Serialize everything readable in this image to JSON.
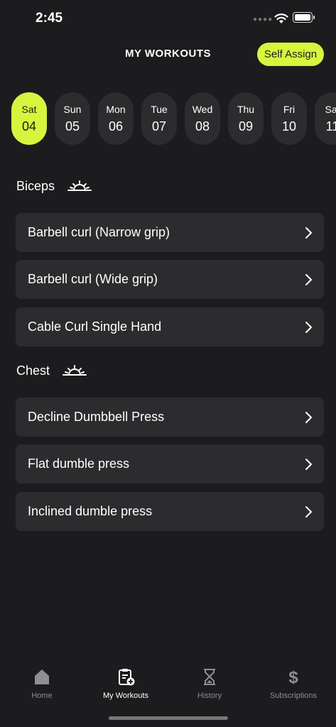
{
  "status": {
    "time": "2:45"
  },
  "header": {
    "title": "MY WORKOUTS",
    "self_assign_label": "Self Assign"
  },
  "days": [
    {
      "name": "Sat",
      "num": "04"
    },
    {
      "name": "Sun",
      "num": "05"
    },
    {
      "name": "Mon",
      "num": "06"
    },
    {
      "name": "Tue",
      "num": "07"
    },
    {
      "name": "Wed",
      "num": "08"
    },
    {
      "name": "Thu",
      "num": "09"
    },
    {
      "name": "Fri",
      "num": "10"
    },
    {
      "name": "Sat",
      "num": "11"
    }
  ],
  "selected_day_index": 0,
  "groups": [
    {
      "title": "Biceps",
      "icon": "sunrise-icon",
      "exercises": [
        "Barbell curl (Narrow grip)",
        "Barbell curl (Wide grip)",
        "Cable Curl Single Hand"
      ]
    },
    {
      "title": "Chest",
      "icon": "sunrise-icon",
      "exercises": [
        "Decline Dumbbell Press",
        "Flat dumble press",
        "Inclined dumble press"
      ]
    }
  ],
  "nav": {
    "items": [
      {
        "label": "Home",
        "icon": "home-icon"
      },
      {
        "label": "My Workouts",
        "icon": "clipboard-plus-icon"
      },
      {
        "label": "History",
        "icon": "hourglass-icon"
      },
      {
        "label": "Subscriptions",
        "icon": "dollar-icon"
      }
    ],
    "active_index": 1
  },
  "colors": {
    "accent": "#d7f53d",
    "background": "#1c1c1e",
    "card": "#2c2c2e",
    "inactive": "#8e8e93"
  }
}
